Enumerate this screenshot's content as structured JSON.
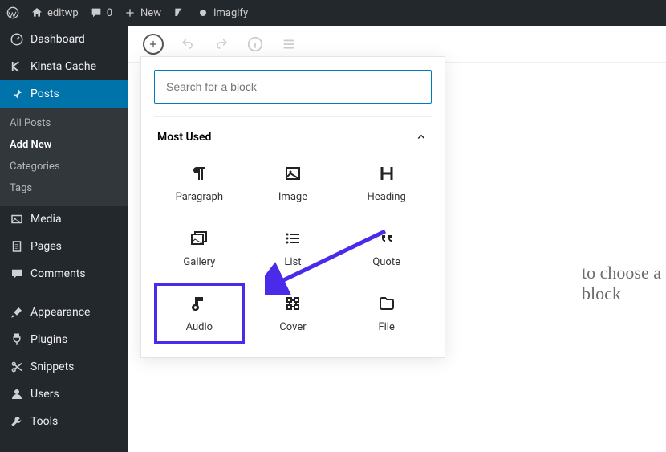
{
  "topbar": {
    "site": "editwp",
    "comments": "0",
    "new": "New",
    "imagify": "Imagify"
  },
  "sidebar": {
    "dashboard": "Dashboard",
    "kinsta": "Kinsta Cache",
    "posts": "Posts",
    "posts_sub": {
      "all": "All Posts",
      "add": "Add New",
      "cat": "Categories",
      "tags": "Tags"
    },
    "media": "Media",
    "pages": "Pages",
    "comments": "Comments",
    "appearance": "Appearance",
    "plugins": "Plugins",
    "snippets": "Snippets",
    "users": "Users",
    "tools": "Tools"
  },
  "editor": {
    "hint": "to choose a block"
  },
  "inserter": {
    "search_placeholder": "Search for a block",
    "section": "Most Used",
    "blocks": {
      "paragraph": "Paragraph",
      "image": "Image",
      "heading": "Heading",
      "gallery": "Gallery",
      "list": "List",
      "quote": "Quote",
      "audio": "Audio",
      "cover": "Cover",
      "file": "File"
    }
  }
}
